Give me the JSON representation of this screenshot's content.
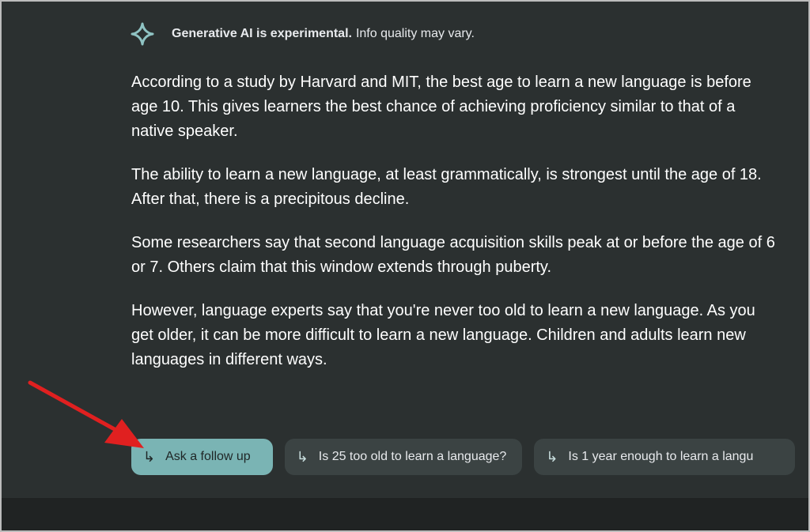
{
  "header": {
    "bold_text": "Generative AI is experimental.",
    "rest_text": "Info quality may vary.",
    "icon": "sparkle-icon"
  },
  "paragraphs": [
    "According to a study by Harvard and MIT, the best age to learn a new language is before age 10. This gives learners the best chance of achieving proficiency similar to that of a native speaker.",
    "The ability to learn a new language, at least grammatically, is strongest until the age of 18. After that, there is a precipitous decline.",
    "Some researchers say that second language acquisition skills peak at or before the age of 6 or 7. Others claim that this window extends through puberty.",
    "However, language experts say that you're never too old to learn a new language. As you get older, it can be more difficult to learn a new language. Children and adults learn new languages in different ways."
  ],
  "chips": [
    {
      "label": "Ask a follow up",
      "icon": "follow-up-arrow-icon"
    },
    {
      "label": "Is 25 too old to learn a language?",
      "icon": "follow-up-arrow-icon"
    },
    {
      "label": "Is 1 year enough to learn a langu",
      "icon": "follow-up-arrow-icon"
    }
  ],
  "colors": {
    "background": "#2b3030",
    "primary_chip": "#7ab4b4",
    "secondary_chip": "#3b4343",
    "pointer_arrow": "#e02020"
  }
}
